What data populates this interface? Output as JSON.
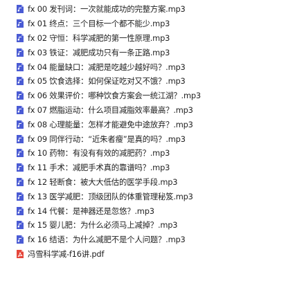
{
  "files": [
    {
      "name": "fx 00 发刊词：一次就能成功的完整方案.mp3",
      "type": "audio",
      "icon": "audio-file-icon",
      "color": "#4a5bd4"
    },
    {
      "name": "fx 01 终点：三个目标一个都不能少.mp3",
      "type": "audio",
      "icon": "audio-file-icon",
      "color": "#4a5bd4"
    },
    {
      "name": "fx 02 守恒：科学减肥的第一性原理.mp3",
      "type": "audio",
      "icon": "audio-file-icon",
      "color": "#4a5bd4"
    },
    {
      "name": "fx 03 铁证：减肥成功只有一条正路.mp3",
      "type": "audio",
      "icon": "audio-file-icon",
      "color": "#4a5bd4"
    },
    {
      "name": "fx 04 能量缺口：减肥是吃越少越好吗？.mp3",
      "type": "audio",
      "icon": "audio-file-icon",
      "color": "#4a5bd4"
    },
    {
      "name": "fx 05 饮食选择：如何保证吃对又不饿？.mp3",
      "type": "audio",
      "icon": "audio-file-icon",
      "color": "#4a5bd4"
    },
    {
      "name": "fx 06 效果评价：哪种饮食方案会一统江湖？.mp3",
      "type": "audio",
      "icon": "audio-file-icon",
      "color": "#4a5bd4"
    },
    {
      "name": "fx 07 燃脂运动：什么项目减脂效率最高？.mp3",
      "type": "audio",
      "icon": "audio-file-icon",
      "color": "#4a5bd4"
    },
    {
      "name": "fx 08 心理能量：怎样才能避免中途放弃？.mp3",
      "type": "audio",
      "icon": "audio-file-icon",
      "color": "#4a5bd4"
    },
    {
      "name": "fx 09 同伴行动：“近朱者瘦”是真的吗？.mp3",
      "type": "audio",
      "icon": "audio-file-icon",
      "color": "#4a5bd4"
    },
    {
      "name": "fx 10 药物：有没有有效的减肥药？.mp3",
      "type": "audio",
      "icon": "audio-file-icon",
      "color": "#4a5bd4"
    },
    {
      "name": "fx 11 手术：减肥手术真的靠谱吗？.mp3",
      "type": "audio",
      "icon": "audio-file-icon",
      "color": "#4a5bd4"
    },
    {
      "name": "fx 12 轻断食：被大大低估的医学手段.mp3",
      "type": "audio",
      "icon": "audio-file-icon",
      "color": "#4a5bd4"
    },
    {
      "name": "fx 13 医学减肥：顶级团队的体重管理秘笈.mp3",
      "type": "audio",
      "icon": "audio-file-icon",
      "color": "#4a5bd4"
    },
    {
      "name": "fx 14 代餐：是神器还是忽悠？.mp3",
      "type": "audio",
      "icon": "audio-file-icon",
      "color": "#4a5bd4"
    },
    {
      "name": "fx 15 婴儿肥：为什么必须马上减掉？.mp3",
      "type": "audio",
      "icon": "audio-file-icon",
      "color": "#4a5bd4"
    },
    {
      "name": "fx 16 结语：为什么减肥不是个人问题？.mp3",
      "type": "audio",
      "icon": "audio-file-icon",
      "color": "#4a5bd4"
    },
    {
      "name": "冯雪科学减-f16讲.pdf",
      "type": "pdf",
      "icon": "pdf-file-icon",
      "color": "#e5463b"
    }
  ]
}
